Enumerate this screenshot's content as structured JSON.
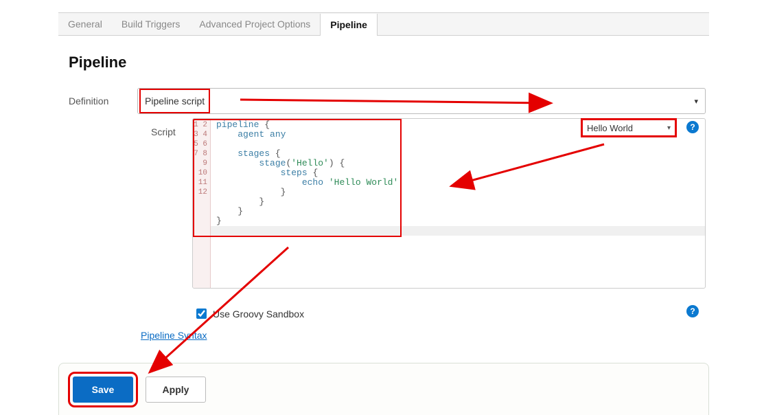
{
  "tabs": {
    "general": "General",
    "build_triggers": "Build Triggers",
    "advanced": "Advanced Project Options",
    "pipeline": "Pipeline"
  },
  "section_title": "Pipeline",
  "definition": {
    "label": "Definition",
    "selected": "Pipeline script"
  },
  "script": {
    "label": "Script",
    "sample_selected": "Hello World",
    "line_numbers": [
      "1",
      "2",
      "3",
      "4",
      "5",
      "6",
      "7",
      "8",
      "9",
      "10",
      "11",
      "12"
    ],
    "code_lines": [
      "pipeline {",
      "    agent any",
      "",
      "    stages {",
      "        stage('Hello') {",
      "            steps {",
      "                echo 'Hello World'",
      "            }",
      "        }",
      "    }",
      "}",
      ""
    ]
  },
  "sandbox": {
    "label": "Use Groovy Sandbox",
    "checked": true
  },
  "links": {
    "pipeline_syntax": "Pipeline Syntax"
  },
  "footer": {
    "save": "Save",
    "apply": "Apply"
  },
  "icons": {
    "help": "?"
  }
}
